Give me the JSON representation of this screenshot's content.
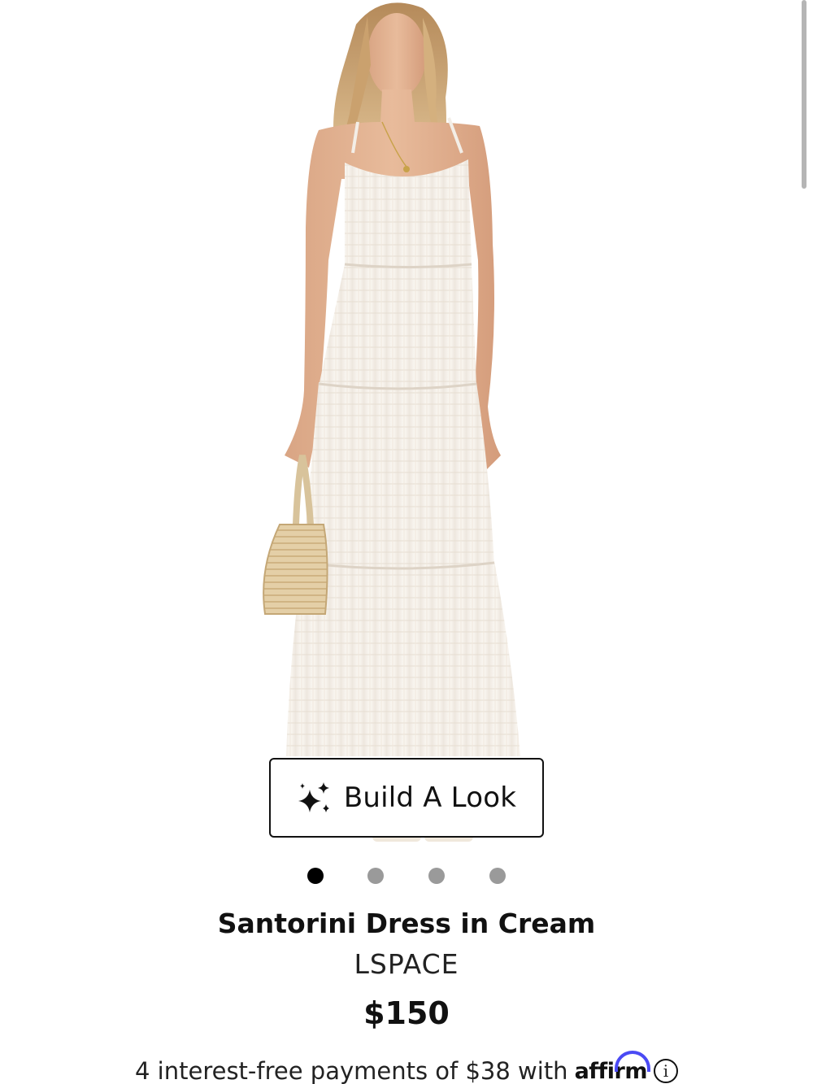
{
  "product": {
    "title": "Santorini Dress in Cream",
    "brand": "LSPACE",
    "price": "$150",
    "image_alt": "Model wearing cream tiered maxi dress holding a woven bag"
  },
  "build_look": {
    "label": "Build A Look",
    "icon": "sparkle-icon"
  },
  "carousel": {
    "total": 4,
    "active_index": 0
  },
  "financing": {
    "text": "4 interest-free payments of $38 with",
    "provider": "affirm",
    "info_icon": "info-icon"
  },
  "colors": {
    "accent_affirm": "#4a4af4",
    "dot_active": "#000000",
    "dot_inactive": "#9a9a9a"
  }
}
